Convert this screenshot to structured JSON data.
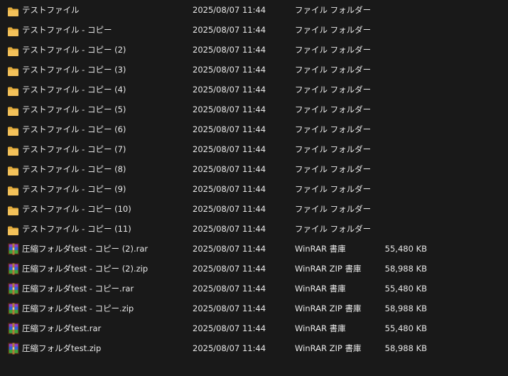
{
  "colors": {
    "background": "#191919",
    "text": "#e8e8e8",
    "folder_body": "#f4c25a",
    "folder_tab": "#e0a93a"
  },
  "files": [
    {
      "name": "テストファイル",
      "date": "2025/08/07 11:44",
      "type": "ファイル フォルダー",
      "size": "",
      "icon": "folder-icon"
    },
    {
      "name": "テストファイル - コピー",
      "date": "2025/08/07 11:44",
      "type": "ファイル フォルダー",
      "size": "",
      "icon": "folder-icon"
    },
    {
      "name": "テストファイル - コピー (2)",
      "date": "2025/08/07 11:44",
      "type": "ファイル フォルダー",
      "size": "",
      "icon": "folder-icon"
    },
    {
      "name": "テストファイル - コピー (3)",
      "date": "2025/08/07 11:44",
      "type": "ファイル フォルダー",
      "size": "",
      "icon": "folder-icon"
    },
    {
      "name": "テストファイル - コピー (4)",
      "date": "2025/08/07 11:44",
      "type": "ファイル フォルダー",
      "size": "",
      "icon": "folder-icon"
    },
    {
      "name": "テストファイル - コピー (5)",
      "date": "2025/08/07 11:44",
      "type": "ファイル フォルダー",
      "size": "",
      "icon": "folder-icon"
    },
    {
      "name": "テストファイル - コピー (6)",
      "date": "2025/08/07 11:44",
      "type": "ファイル フォルダー",
      "size": "",
      "icon": "folder-icon"
    },
    {
      "name": "テストファイル - コピー (7)",
      "date": "2025/08/07 11:44",
      "type": "ファイル フォルダー",
      "size": "",
      "icon": "folder-icon"
    },
    {
      "name": "テストファイル - コピー (8)",
      "date": "2025/08/07 11:44",
      "type": "ファイル フォルダー",
      "size": "",
      "icon": "folder-icon"
    },
    {
      "name": "テストファイル - コピー (9)",
      "date": "2025/08/07 11:44",
      "type": "ファイル フォルダー",
      "size": "",
      "icon": "folder-icon"
    },
    {
      "name": "テストファイル - コピー (10)",
      "date": "2025/08/07 11:44",
      "type": "ファイル フォルダー",
      "size": "",
      "icon": "folder-icon"
    },
    {
      "name": "テストファイル - コピー (11)",
      "date": "2025/08/07 11:44",
      "type": "ファイル フォルダー",
      "size": "",
      "icon": "folder-icon"
    },
    {
      "name": "圧縮フォルダtest - コピー (2).rar",
      "date": "2025/08/07 11:44",
      "type": "WinRAR 書庫",
      "size": "55,480 KB",
      "icon": "winrar-archive-icon"
    },
    {
      "name": "圧縮フォルダtest - コピー (2).zip",
      "date": "2025/08/07 11:44",
      "type": "WinRAR ZIP 書庫",
      "size": "58,988 KB",
      "icon": "winrar-archive-icon"
    },
    {
      "name": "圧縮フォルダtest - コピー.rar",
      "date": "2025/08/07 11:44",
      "type": "WinRAR 書庫",
      "size": "55,480 KB",
      "icon": "winrar-archive-icon"
    },
    {
      "name": "圧縮フォルダtest - コピー.zip",
      "date": "2025/08/07 11:44",
      "type": "WinRAR ZIP 書庫",
      "size": "58,988 KB",
      "icon": "winrar-archive-icon"
    },
    {
      "name": "圧縮フォルダtest.rar",
      "date": "2025/08/07 11:44",
      "type": "WinRAR 書庫",
      "size": "55,480 KB",
      "icon": "winrar-archive-icon"
    },
    {
      "name": "圧縮フォルダtest.zip",
      "date": "2025/08/07 11:44",
      "type": "WinRAR ZIP 書庫",
      "size": "58,988 KB",
      "icon": "winrar-archive-icon"
    }
  ]
}
